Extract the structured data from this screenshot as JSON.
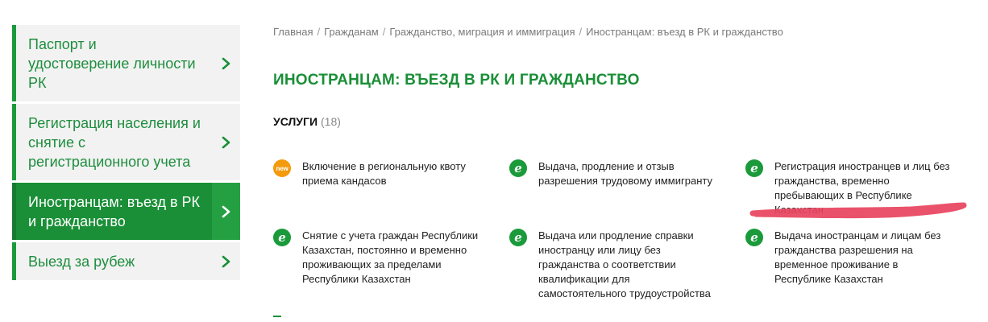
{
  "sidebar": {
    "items": [
      {
        "label": "Паспорт и удостоверение личности РК",
        "active": false
      },
      {
        "label": "Регистрация населения и снятие с регистрационного учета",
        "active": false
      },
      {
        "label": "Иностранцам: въезд в РК и гражданство",
        "active": true
      },
      {
        "label": "Выезд за рубеж",
        "active": false
      }
    ]
  },
  "breadcrumb": {
    "items": [
      "Главная",
      "Гражданам",
      "Гражданство, миграция и иммиграция",
      "Иностранцам: въезд в РК и гражданство"
    ],
    "separator": "/"
  },
  "page": {
    "title": "ИНОСТРАНЦАМ: ВЪЕЗД В РК И ГРАЖДАНСТВО"
  },
  "services": {
    "heading": "УСЛУГИ",
    "count": "(18)",
    "items": [
      {
        "badge": "new",
        "badge_icon": "new-badge-icon",
        "text": "Включение в региональную квоту приема кандасов"
      },
      {
        "badge": "e",
        "badge_icon": "e-service-icon",
        "text": "Выдача, продление и отзыв разрешения трудовому иммигранту"
      },
      {
        "badge": "e",
        "badge_icon": "e-service-icon",
        "text": "Регистрация иностранцев и лиц без гражданства, временно пребывающих в Республике Казахстан"
      },
      {
        "badge": "e",
        "badge_icon": "e-service-icon",
        "text": "Снятие с учета граждан Республики Казахстан, постоянно и временно проживающих за пределами Республики Казахстан"
      },
      {
        "badge": "e",
        "badge_icon": "e-service-icon",
        "text": "Выдача или продление справки иностранцу или лицу без гражданства о соответствии квалификации для самостоятельного трудоустройства"
      },
      {
        "badge": "e",
        "badge_icon": "e-service-icon",
        "text": "Выдача иностранцам и лицам без гражданства разрешения на временное проживание в Республике Казахстан"
      }
    ]
  },
  "colors": {
    "brand_green": "#1a8f37",
    "badge_green": "#1a9a3a",
    "new_orange": "#f39a0e",
    "annotation_red": "#e8435e"
  }
}
